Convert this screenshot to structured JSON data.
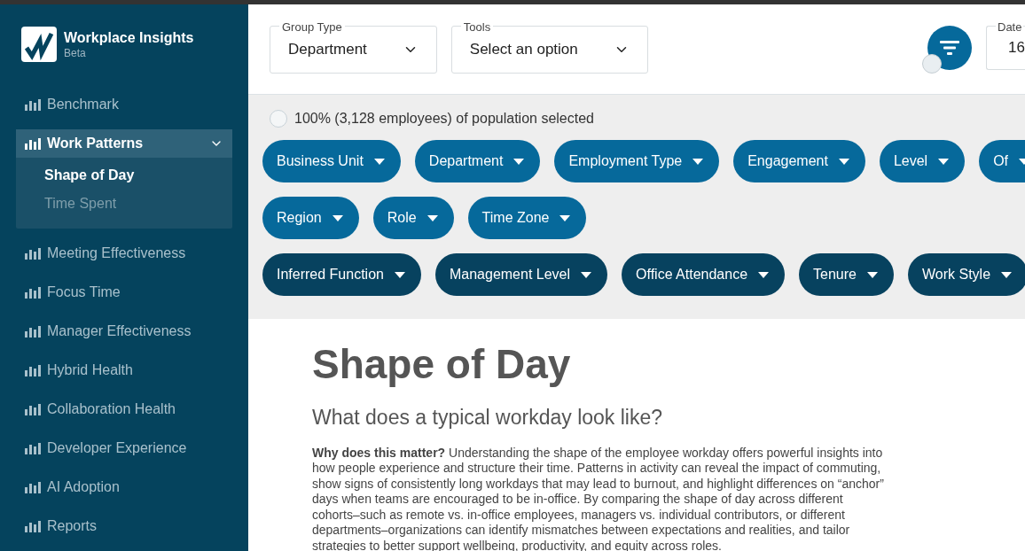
{
  "brand": {
    "title": "Workplace Insights",
    "subtitle": "Beta"
  },
  "sidebar": {
    "items": [
      {
        "label": "Benchmark",
        "selected": false
      },
      {
        "label": "Work Patterns",
        "selected": true,
        "expanded": true,
        "children": [
          {
            "label": "Shape of Day",
            "selected": true
          },
          {
            "label": "Time Spent",
            "selected": false
          }
        ]
      },
      {
        "label": "Meeting Effectiveness",
        "selected": false
      },
      {
        "label": "Focus Time",
        "selected": false
      },
      {
        "label": "Manager Effectiveness",
        "selected": false
      },
      {
        "label": "Hybrid Health",
        "selected": false
      },
      {
        "label": "Collaboration Health",
        "selected": false
      },
      {
        "label": "Developer Experience",
        "selected": false
      },
      {
        "label": "AI Adoption",
        "selected": false
      },
      {
        "label": "Reports",
        "selected": false
      }
    ]
  },
  "toolbar": {
    "selects": [
      {
        "label": "Group Type",
        "value": "Department"
      },
      {
        "label": "Tools",
        "value": "Select an option"
      }
    ],
    "date": {
      "label": "Date",
      "value": "16"
    }
  },
  "population": {
    "checked": false,
    "text": "100% (3,128 employees) of population selected"
  },
  "filter_rows": [
    [
      {
        "label": "Business Unit",
        "kind": "attribute"
      },
      {
        "label": "Department",
        "kind": "attribute"
      },
      {
        "label": "Employment Type",
        "kind": "attribute"
      },
      {
        "label": "Engagement",
        "kind": "attribute"
      },
      {
        "label": "Level",
        "kind": "attribute"
      },
      {
        "label": "Of",
        "kind": "attribute"
      }
    ],
    [
      {
        "label": "Region",
        "kind": "attribute"
      },
      {
        "label": "Role",
        "kind": "attribute"
      },
      {
        "label": "Time Zone",
        "kind": "attribute"
      }
    ],
    [
      {
        "label": "Inferred Function",
        "kind": "inferred"
      },
      {
        "label": "Management Level",
        "kind": "inferred"
      },
      {
        "label": "Office Attendance",
        "kind": "inferred"
      },
      {
        "label": "Tenure",
        "kind": "inferred"
      },
      {
        "label": "Work Style",
        "kind": "inferred"
      }
    ]
  ],
  "content": {
    "title": "Shape of Day",
    "subtitle": "What does a typical workday look like?",
    "body": "**Why does this matter?** Understanding the shape of the employee workday offers powerful insights into how people experience and structure their time. Patterns in activity can reveal the impact of commuting, show signs of consistently long workdays that may lead to burnout, and highlight differences on “anchor” days when teams are encouraged to be in-office. By comparing the shape of day across different cohorts–such as remote vs. in-office employees, managers vs. individual contributors, or different departments–organizations can identify mismatches between expectations and realities, and tailor strategies to better support wellbeing, productivity, and equity across roles."
  }
}
